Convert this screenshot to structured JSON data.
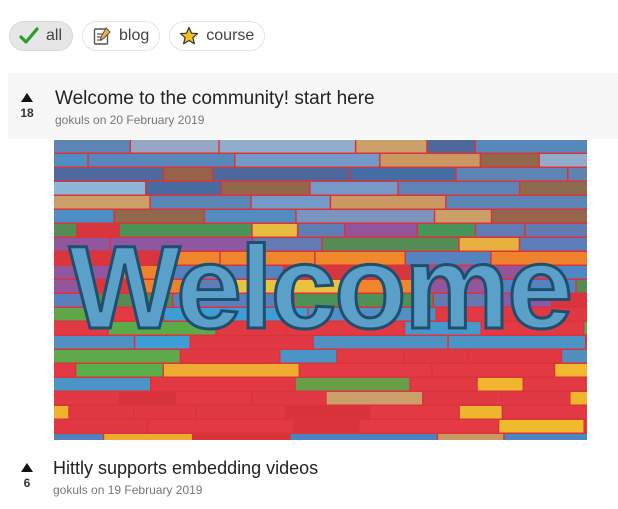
{
  "filters": [
    {
      "label": "all",
      "icon": "check-icon",
      "active": true
    },
    {
      "label": "blog",
      "icon": "notepad-icon",
      "active": false
    },
    {
      "label": "course",
      "icon": "star-icon",
      "active": false
    }
  ],
  "posts": [
    {
      "votes": "18",
      "title": "Welcome to the community! start here",
      "author": "gokuls",
      "date_prefix": "on",
      "date": "20 February 2019",
      "image_text": "Welcome"
    },
    {
      "votes": "6",
      "title": "Hittly supports embedding videos",
      "author": "gokuls",
      "date_prefix": "on",
      "date": "19 February 2019"
    }
  ],
  "colors": {
    "accent_check": "#2e9b2e",
    "star": "#f6c21a",
    "hero_base": "#d9343b"
  }
}
